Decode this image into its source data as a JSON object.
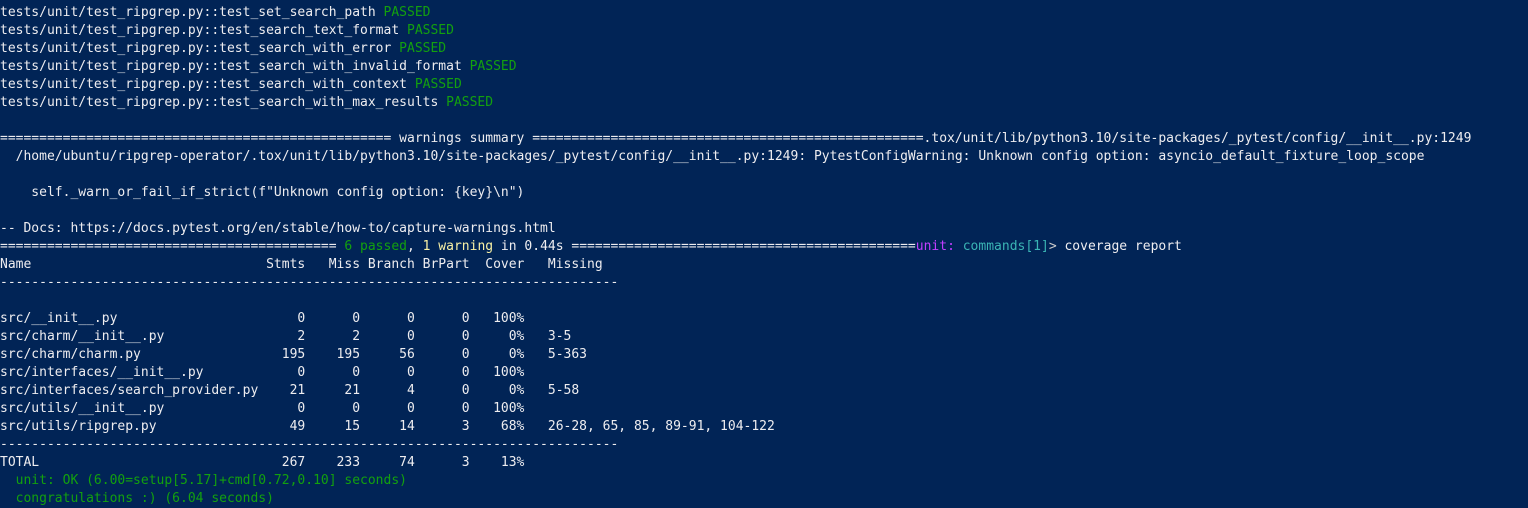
{
  "test_lines": [
    {
      "path": "tests/unit/test_ripgrep.py::test_set_search_path",
      "status": "PASSED"
    },
    {
      "path": "tests/unit/test_ripgrep.py::test_search_text_format",
      "status": "PASSED"
    },
    {
      "path": "tests/unit/test_ripgrep.py::test_search_with_error",
      "status": "PASSED"
    },
    {
      "path": "tests/unit/test_ripgrep.py::test_search_with_invalid_format",
      "status": "PASSED"
    },
    {
      "path": "tests/unit/test_ripgrep.py::test_search_with_context",
      "status": "PASSED"
    },
    {
      "path": "tests/unit/test_ripgrep.py::test_search_with_max_results",
      "status": "PASSED"
    }
  ],
  "warnings": {
    "header": "================================================== warnings summary ==================================================.tox/unit/lib/python3.10/site-packages/_pytest/config/__init__.py:1249",
    "detail": "  /home/ubuntu/ripgrep-operator/.tox/unit/lib/python3.10/site-packages/_pytest/config/__init__.py:1249: PytestConfigWarning: Unknown config option: asyncio_default_fixture_loop_scope",
    "code": "    self._warn_or_fail_if_strict(f\"Unknown config option: {key}\\n\")",
    "docs": "-- Docs: https://docs.pytest.org/en/stable/how-to/capture-warnings.html"
  },
  "summary": {
    "eq_left": "=========================================== ",
    "passed": "6 passed",
    "sep": ", ",
    "warning": "1 warning",
    "time": " in 0.44s ",
    "eq_right": "============================================",
    "unit_label": "unit:",
    "commands": " commands[1]",
    "prompt": "> ",
    "command": "coverage report"
  },
  "coverage": {
    "header": "Name                              Stmts   Miss Branch BrPart  Cover   Missing",
    "divider": "-------------------------------------------------------------------------------",
    "rows": [
      "src/__init__.py                       0      0      0      0   100%",
      "src/charm/__init__.py                 2      2      0      0     0%   3-5",
      "src/charm/charm.py                  195    195     56      0     0%   5-363",
      "src/interfaces/__init__.py            0      0      0      0   100%",
      "src/interfaces/search_provider.py    21     21      4      0     0%   5-58",
      "src/utils/__init__.py                 0      0      0      0   100%",
      "src/utils/ripgrep.py                 49     15     14      3    68%   26-28, 65, 85, 89-91, 104-122"
    ],
    "total": "TOTAL                               267    233     74      3    13%"
  },
  "result": {
    "ok": "  unit: OK (6.00=setup[5.17]+cmd[0.72,0.10] seconds)",
    "congrats": "  congratulations :) (6.04 seconds)"
  },
  "colors": {
    "background": "#012456",
    "text": "#eeedf0",
    "passed": "#13a10e",
    "warning": "#f9f1a5",
    "unit": "#c13fff"
  }
}
